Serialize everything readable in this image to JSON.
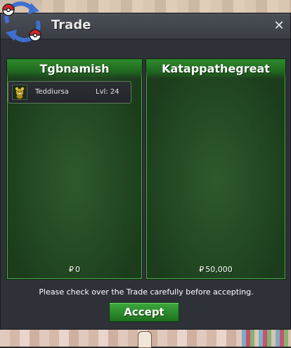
{
  "window": {
    "title": "Trade",
    "close_glyph": "✕"
  },
  "left_panel": {
    "player_name": "Tgbnamish",
    "money_symbol": "₽",
    "money": "0",
    "pokemon": [
      {
        "name": "Teddiursa",
        "level": "Lvl: 24",
        "icon": "teddiursa-sprite-icon"
      }
    ]
  },
  "right_panel": {
    "player_name": "Katappathegreat",
    "money_symbol": "₽",
    "money": "50,000",
    "pokemon": []
  },
  "footer": {
    "notice": "Please check over the Trade carefully before accepting.",
    "accept_label": "Accept"
  },
  "colors": {
    "panel_green": "#234a23",
    "header_green": "#2e8a2e",
    "button_green": "#2a8a2a",
    "window_bg": "#2e3138",
    "title_bar": "#4b4f57"
  },
  "icons": {
    "trade": "trade-swap-icon",
    "close": "close-icon",
    "money": "pokedollar-icon"
  }
}
